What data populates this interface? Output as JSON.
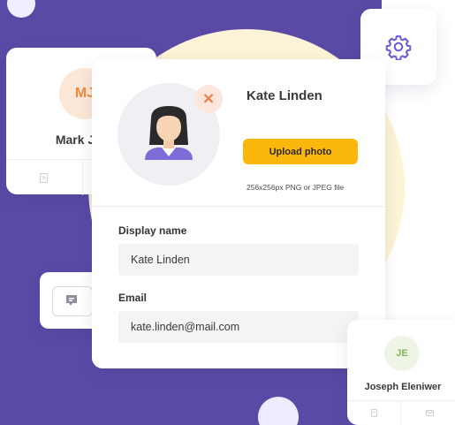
{
  "colors": {
    "background_purple": "#5a4aa6",
    "accent_yellow": "#fcb70d",
    "remove_orange": "#f07a45",
    "gear_purple": "#6a5ad6"
  },
  "mark_card": {
    "initials": "MJ",
    "name": "Mark Jor",
    "footer_icons": [
      "document-icon",
      "mail-icon"
    ]
  },
  "settings_card": {
    "icon": "gear-icon"
  },
  "message_widget": {
    "icon": "chat-icon"
  },
  "joseph_card": {
    "initials": "JE",
    "name": "Joseph Eleniwer",
    "footer_icons": [
      "document-icon",
      "mail-icon"
    ]
  },
  "profile": {
    "name": "Kate Linden",
    "remove_icon_glyph": "×",
    "upload_label": "Upload photo",
    "upload_hint": "256x256px PNG or JPEG file",
    "display_name_label": "Display name",
    "display_name_value": "Kate Linden",
    "email_label": "Email",
    "email_value": "kate.linden@mail.com"
  }
}
